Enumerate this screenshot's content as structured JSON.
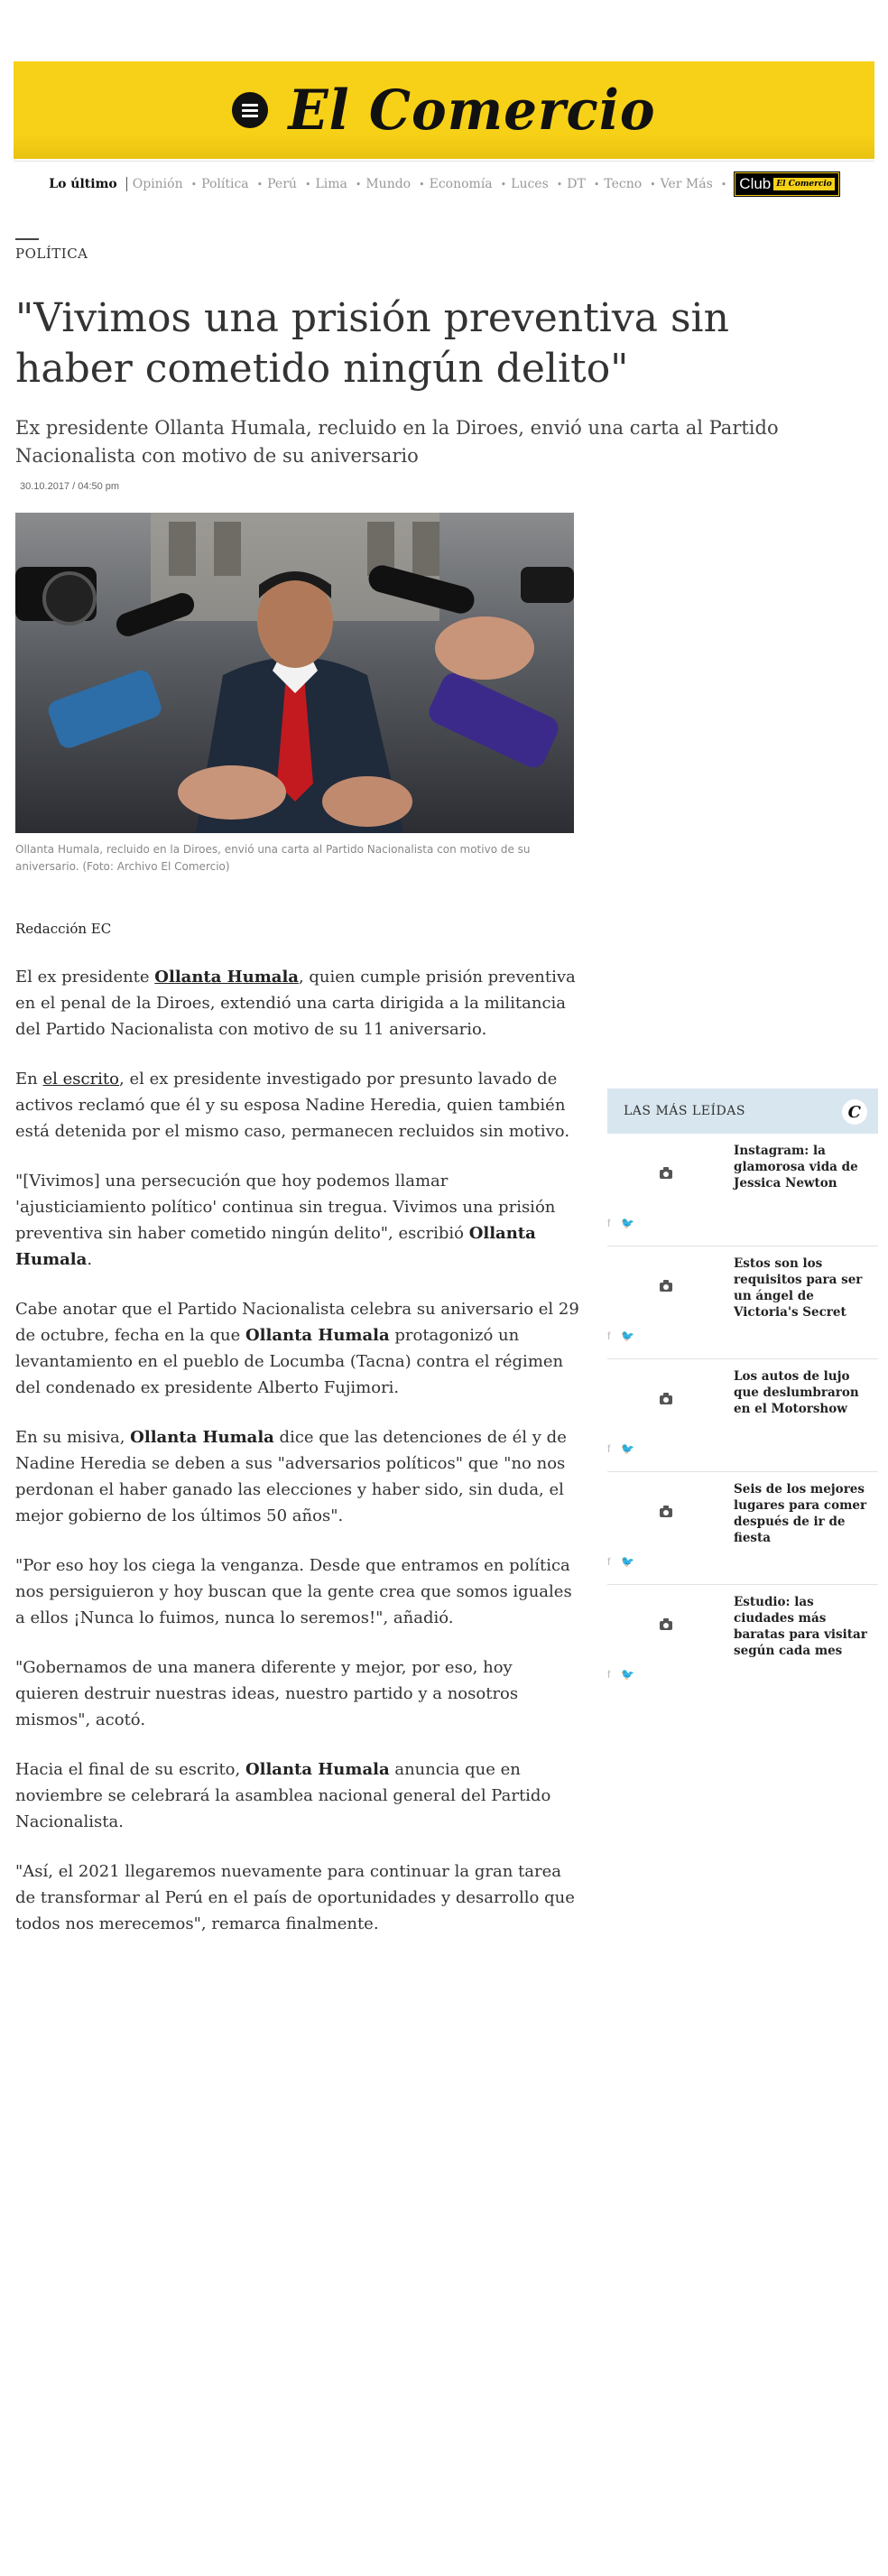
{
  "header": {
    "logo_text": "El Comercio",
    "brand_color": "#f7d117"
  },
  "nav": {
    "latest": "Lo último",
    "items": [
      "Opinión",
      "Política",
      "Perú",
      "Lima",
      "Mundo",
      "Economía",
      "Luces",
      "DT",
      "Tecno",
      "Ver Más"
    ],
    "club_label": "Club",
    "club_badge": "El Comercio"
  },
  "article": {
    "section": "POLÍTICA",
    "headline": "\"Vivimos una prisión preventiva sin haber cometido ningún delito\"",
    "subheadline": "Ex presidente Ollanta Humala, recluido en la Diroes, envió una carta al Partido Nacionalista con motivo de su aniversario",
    "date": "30.10.2017 / 04:50 pm",
    "caption": "Ollanta Humala, recluido en la Diroes, envió una carta al Partido Nacionalista con motivo de su aniversario. (Foto: Archivo El Comercio)",
    "byline": "Redacción EC",
    "p1": {
      "a": "El ex presidente ",
      "link": "Ollanta Humala",
      "b": ", quien cumple prisión preventiva en el penal de la Diroes, extendió una carta dirigida a la militancia del Partido Nacionalista con motivo de su 11 aniversario."
    },
    "p2": {
      "a": "En ",
      "link": "el escrito",
      "b": ", el ex presidente investigado por presunto lavado de activos reclamó que él y su esposa Nadine Heredia, quien también está detenida por el mismo caso, permanecen recluidos sin motivo."
    },
    "p3": {
      "a": "\"[Vivimos] una persecución que hoy podemos llamar 'ajusticiamiento político' continua sin tregua. Vivimos una prisión preventiva sin haber cometido ningún delito\", escribió ",
      "bold": "Ollanta Humala",
      "b": "."
    },
    "p4": {
      "a": "Cabe anotar que el Partido Nacionalista celebra su aniversario el 29 de octubre, fecha en la que ",
      "bold": "Ollanta Humala",
      "b": " protagonizó un levantamiento en el pueblo de Locumba (Tacna) contra el régimen del condenado ex presidente Alberto Fujimori."
    },
    "p5": {
      "a": "En su misiva, ",
      "bold": "Ollanta Humala",
      "b": " dice que las detenciones de él y de Nadine Heredia se deben a sus \"adversarios políticos\" que \"no nos perdonan el haber ganado las elecciones y haber sido, sin duda, el mejor gobierno de los últimos 50 años\"."
    },
    "p6": "\"Por eso hoy los ciega la venganza. Desde que entramos en política nos persiguieron y hoy buscan que la gente crea que somos iguales a ellos ¡Nunca lo fuimos, nunca lo seremos!\", añadió.",
    "p7": "\"Gobernamos de una manera diferente y mejor, por eso, hoy quieren destruir nuestras ideas, nuestro partido y a nosotros mismos\", acotó.",
    "p8": {
      "a": "Hacia el final de su escrito, ",
      "bold": "Ollanta Humala",
      "b": " anuncia que en noviembre se celebrará la asamblea nacional general del Partido Nacionalista."
    },
    "p9": "\"Así, el 2021 llegaremos nuevamente para continuar la gran tarea de transformar al Perú en el país de oportunidades y desarrollo que todos nos merecemos\", remarca finalmente."
  },
  "sidebar": {
    "title": "LAS MÁS LEÍDAS",
    "logo_letter": "C",
    "facebook": "f",
    "twitter": "🐦",
    "items": [
      {
        "title": "Instagram: la glamorosa vida de Jessica Newton"
      },
      {
        "title": "Estos son los requisitos para ser un ángel de Victoria's Secret"
      },
      {
        "title": "Los autos de lujo que deslumbraron en el Motorshow"
      },
      {
        "title": "Seis de los mejores lugares para comer después de ir de fiesta"
      },
      {
        "title": "Estudio: las ciudades más baratas para visitar según cada mes"
      }
    ]
  }
}
